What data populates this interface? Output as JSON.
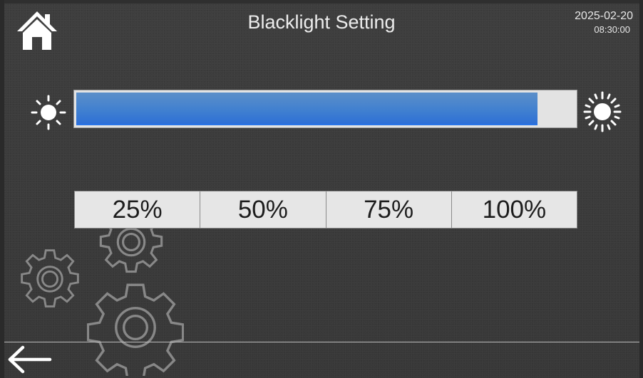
{
  "header": {
    "title": "Blacklight Setting",
    "date": "2025-02-20",
    "time": "08:30:00",
    "home_icon": "home-icon"
  },
  "brightness": {
    "level_fraction": 0.925,
    "min_icon": "sun-dim-icon",
    "max_icon": "sun-bright-icon",
    "fill_color": "#3f7fd0",
    "track_color": "#e3e3e3"
  },
  "presets": [
    {
      "label": "25%"
    },
    {
      "label": "50%"
    },
    {
      "label": "75%"
    },
    {
      "label": "100%"
    }
  ],
  "footer": {
    "back_icon": "back-arrow-icon"
  },
  "decor": {
    "icon": "gear-icon"
  }
}
